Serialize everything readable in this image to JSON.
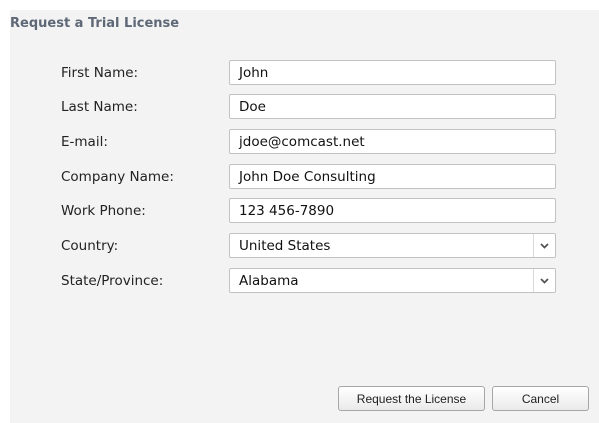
{
  "dialog": {
    "title": "Request a Trial License"
  },
  "form": {
    "first_name": {
      "label": "First Name:",
      "value": "John"
    },
    "last_name": {
      "label": "Last Name:",
      "value": "Doe"
    },
    "email": {
      "label": "E-mail:",
      "value": "jdoe@comcast.net"
    },
    "company": {
      "label": "Company Name:",
      "value": "John Doe Consulting"
    },
    "phone": {
      "label": "Work Phone:",
      "value": "123 456-7890"
    },
    "country": {
      "label": "Country:",
      "value": "United States"
    },
    "state": {
      "label": "State/Province:",
      "value": "Alabama"
    }
  },
  "buttons": {
    "request": "Request the License",
    "cancel": "Cancel"
  },
  "icons": {
    "dropdown": "chevron-down-icon"
  }
}
